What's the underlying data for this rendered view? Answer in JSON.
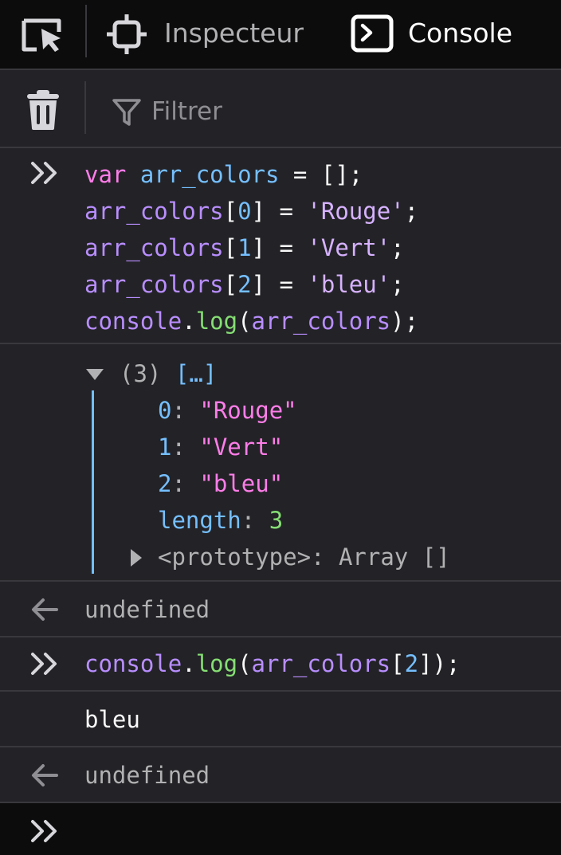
{
  "tabs": {
    "inspector_label": "Inspecteur",
    "console_label": "Console"
  },
  "toolbar": {
    "filter_placeholder": "Filtrer"
  },
  "input1": {
    "line1": {
      "kw": "var",
      "name": "arr_colors",
      "op": " = ",
      "val": "[];"
    },
    "line2": {
      "name": "arr_colors",
      "b1": "[",
      "idx": "0",
      "b2": "]",
      "op": " = ",
      "str": "'Rouge'",
      "end": ";"
    },
    "line3": {
      "name": "arr_colors",
      "b1": "[",
      "idx": "1",
      "b2": "]",
      "op": " = ",
      "str": "'Vert'",
      "end": ";"
    },
    "line4": {
      "name": "arr_colors",
      "b1": "[",
      "idx": "2",
      "b2": "]",
      "op": " = ",
      "str": "'bleu'",
      "end": ";"
    },
    "line5": {
      "obj": "console",
      "dot": ".",
      "fn": "log",
      "p1": "(",
      "arg": "arr_colors",
      "p2": ");"
    }
  },
  "output_array": {
    "header_count": "(3)",
    "header_preview": "[…]",
    "items": [
      {
        "key": "0",
        "sep": ": ",
        "value": "\"Rouge\""
      },
      {
        "key": "1",
        "sep": ": ",
        "value": "\"Vert\""
      },
      {
        "key": "2",
        "sep": ": ",
        "value": "\"bleu\""
      }
    ],
    "length_key": "length",
    "length_sep": ": ",
    "length_value": "3",
    "prototype_label": "<prototype>: Array []"
  },
  "result1": "undefined",
  "input2": {
    "obj": "console",
    "dot": ".",
    "fn": "log",
    "p1": "(",
    "arg": "arr_colors",
    "b1": "[",
    "idx": "2",
    "b2": "]",
    "p2": ");"
  },
  "output2": "bleu",
  "result2": "undefined",
  "colors": {
    "background": "#232327",
    "tabbar_bg": "#0c0c0d",
    "separator": "#38383d",
    "keyword": "#ff7de9",
    "variable": "#b98eff",
    "number": "#75bfff",
    "function": "#86de74"
  },
  "icons": [
    "element-picker-icon",
    "inspector-icon",
    "console-icon",
    "trash-icon",
    "filter-icon",
    "prompt-chevron-icon",
    "arrow-left-icon",
    "expand-triangle-icon",
    "collapse-triangle-icon"
  ]
}
